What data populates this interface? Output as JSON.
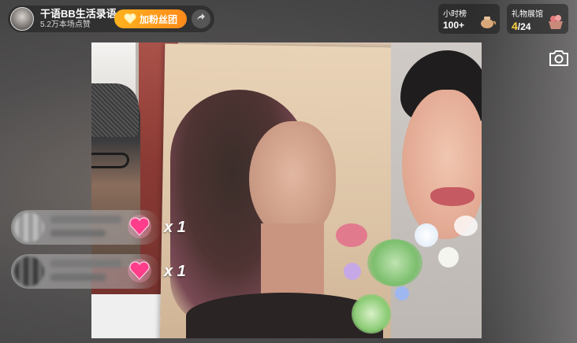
{
  "anchor": {
    "name": "干语BB生活录语",
    "likes": "5.2万本场点赞",
    "fan_button_label": "加粉丝团"
  },
  "rankings": [
    {
      "title": "小时榜",
      "value": "100+"
    },
    {
      "title": "礼物展馆",
      "value_highlight": "4",
      "value_rest": "/24"
    }
  ],
  "gifts": [
    {
      "count": "x 1"
    },
    {
      "count": "x 1"
    }
  ],
  "colors": {
    "fan_button": "#ff9a1c",
    "rank_highlight": "#ffd23e",
    "heart": "#ff3d8b"
  },
  "icons": {
    "share": "share-arrow-icon",
    "camera": "camera-icon",
    "gift": "heart-gift-icon"
  }
}
